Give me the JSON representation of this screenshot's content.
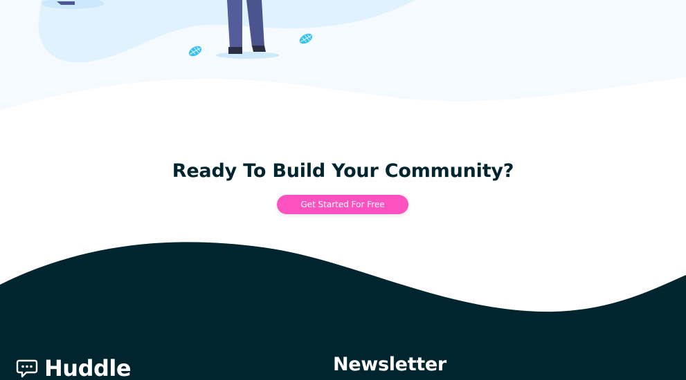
{
  "cta": {
    "title": "Ready To Build Your Community?",
    "button_label": "Get Started For Free"
  },
  "footer": {
    "brand_name": "Huddle",
    "newsletter_title": "Newsletter"
  },
  "colors": {
    "accent": "#ff52c1",
    "footer_bg": "#00252e",
    "hero_bg": "#f5faff",
    "hero_blob": "#dff2fd",
    "title_text": "#00252e"
  },
  "icons": {
    "brand": "chat-bubble-icon",
    "leaf": "leaf-icon"
  }
}
